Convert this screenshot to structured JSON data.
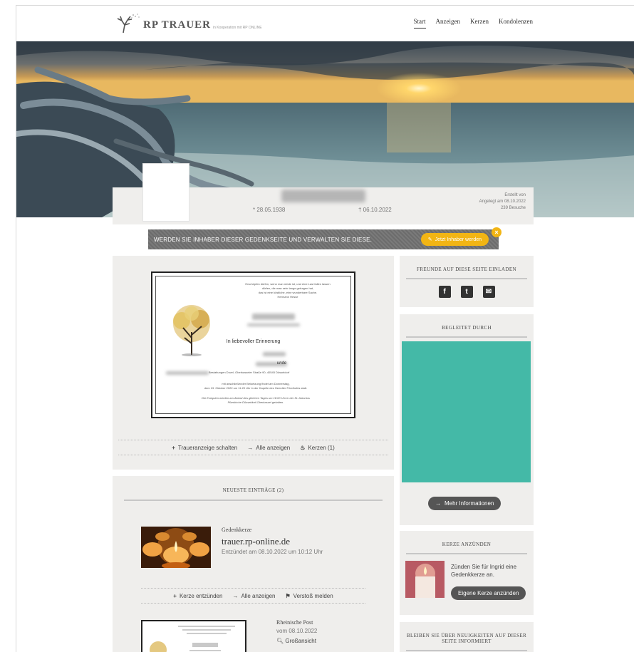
{
  "header": {
    "logo_text": "RP TRAUER",
    "logo_sub": "in Kooperation mit RP ONLINE",
    "nav": [
      {
        "label": "Start",
        "active": true
      },
      {
        "label": "Anzeigen",
        "active": false
      },
      {
        "label": "Kerzen",
        "active": false
      },
      {
        "label": "Kondolenzen",
        "active": false
      }
    ]
  },
  "profile": {
    "birth": "* 28.05.1938",
    "death": "† 06.10.2022",
    "created_by": "Erstellt von",
    "created_on": "Angelegt am 08.10.2022",
    "visits": "239 Besuche"
  },
  "owner_banner": {
    "text": "WERDEN SIE INHABER DIESER GEDENKSEITE UND VERWALTEN SIE DIESE.",
    "button": "Jetzt Inhaber werden",
    "close": "×"
  },
  "notice": {
    "quote": [
      "Erschöpfen dürfen, wenn man müde ist, und eine Last fallen lassen",
      "dürfen, die man sehr lange getragen hat,",
      "das ist eine köstliche, eine wunderbare Sache.",
      "Hermann Hesse"
    ],
    "title": "In liebevoller Erinnerung",
    "family_suffix": "unde",
    "address_end": "Bestattungen Duvel, Oberkasseler Straße 90, 40545 Düsseldorf",
    "service_text": [
      "mit anschließender Beisetzung findet am Donnerstag,",
      "dem 13. Oktober 2022 um 11:20 Uhr in der Kapelle des Heerdter Friedhofes statt."
    ],
    "exequien": [
      "Die Exequien werden am Abend des gleichen Tages um 18:00 Uhr in der St. Antonius",
      "Pfarrkirche Düsseldorf-Oberkassel gehalten."
    ]
  },
  "anzeige_links": [
    {
      "icon": "+",
      "label": "Traueranzeige schalten"
    },
    {
      "icon": "→",
      "label": "Alle anzeigen"
    },
    {
      "icon": "♨",
      "label": "Kerzen (1)"
    }
  ],
  "entries": {
    "title": "NEUESTE EINTRÄGE (2)",
    "candle": {
      "type": "Gedenkkerze",
      "name": "trauer.rp-online.de",
      "date": "Entzündet am 08.10.2022 um 10:12 Uhr"
    },
    "links": [
      {
        "icon": "+",
        "label": "Kerze entzünden"
      },
      {
        "icon": "→",
        "label": "Alle anzeigen"
      },
      {
        "icon": "⚑",
        "label": "Verstoß melden"
      }
    ],
    "anzeige": {
      "source": "Rheinische Post",
      "date": "vom 08.10.2022",
      "zoom": "Großansicht"
    }
  },
  "sidebar": {
    "invite_title": "FREUNDE AUF DIESE SEITE EINLADEN",
    "share_icons": [
      "f",
      "t",
      "✉"
    ],
    "accompanied_title": "BEGLEITET DURCH",
    "more_info": "Mehr Informationen",
    "candle_title": "KERZE ANZÜNDEN",
    "candle_text": "Zünden Sie für Ingrid eine Gedenkkerze an.",
    "candle_button": "Eigene Kerze anzünden",
    "news_title": "BLEIBEN SIE ÜBER NEUIGKEITEN AUF DIESER SEITE INFORMIERT"
  },
  "colors": {
    "accent_yellow": "#f2b514",
    "teal": "#44b9a7",
    "panel": "#efeeec"
  }
}
